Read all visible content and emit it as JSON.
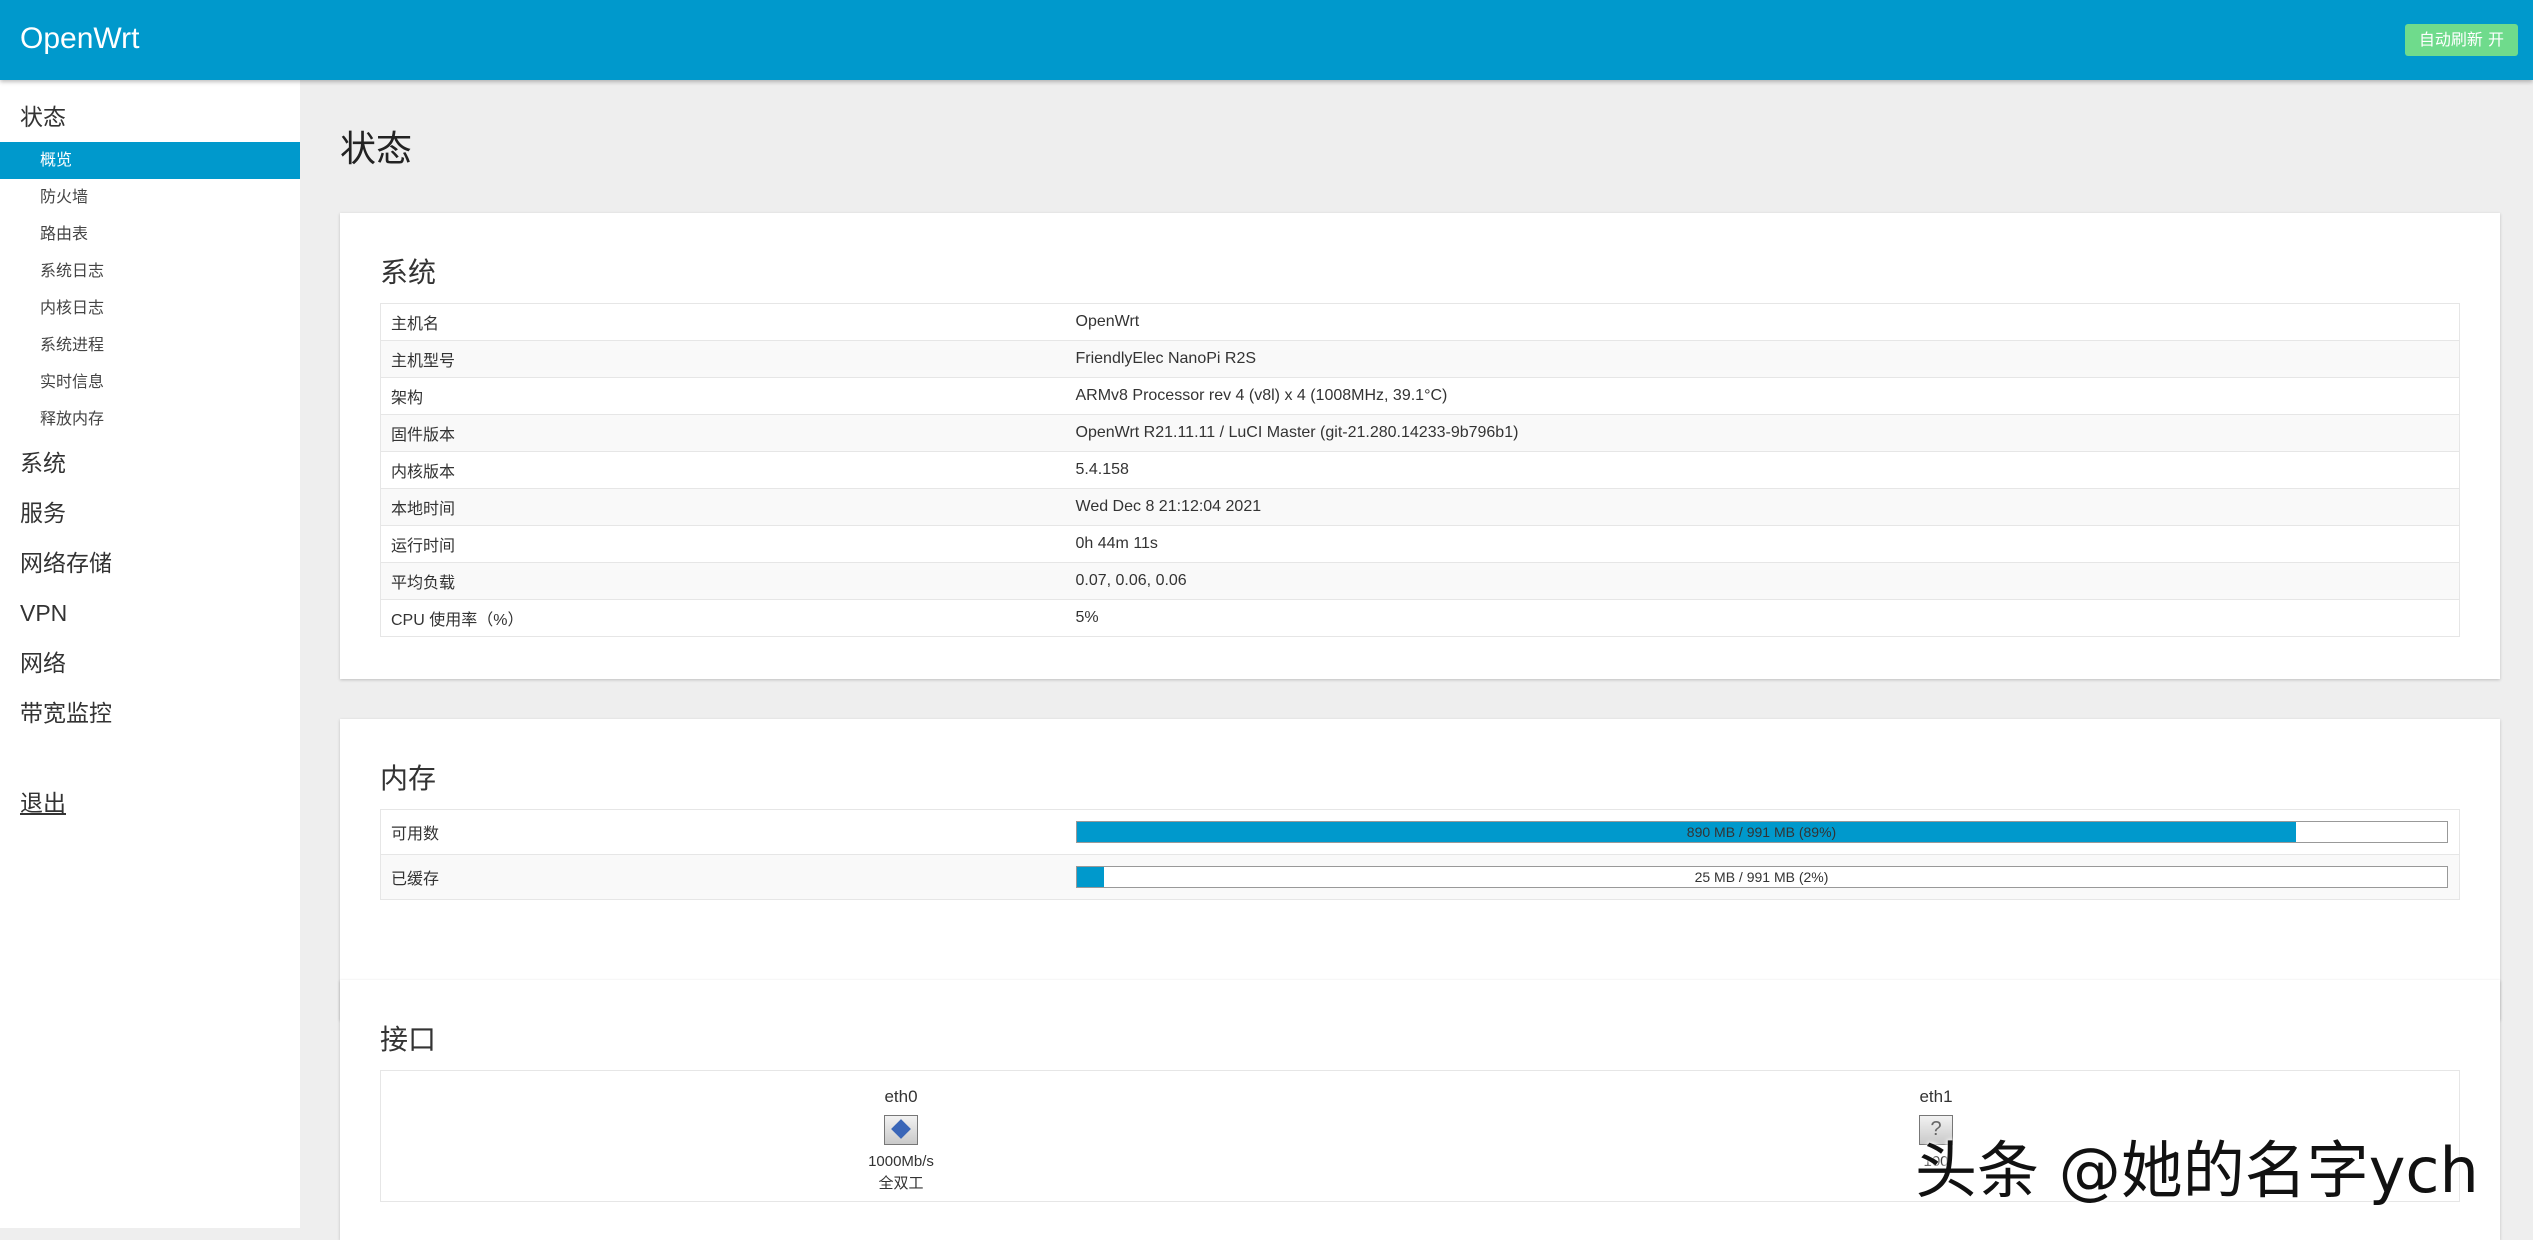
{
  "header": {
    "brand": "OpenWrt",
    "auto_refresh_label": "自动刷新 开",
    "colors": {
      "header_bg": "#0099cc",
      "refresh_bg": "#6fdb8c"
    }
  },
  "sidebar": {
    "status_label": "状态",
    "status_items": [
      "概览",
      "防火墙",
      "路由表",
      "系统日志",
      "内核日志",
      "系统进程",
      "实时信息",
      "释放内存"
    ],
    "active_item": "概览",
    "top_items": [
      "系统",
      "服务",
      "网络存储",
      "VPN",
      "网络",
      "带宽监控"
    ],
    "logout_label": "退出"
  },
  "main": {
    "page_title": "状态",
    "system": {
      "title": "系统",
      "rows": [
        {
          "key": "主机名",
          "value": "OpenWrt"
        },
        {
          "key": "主机型号",
          "value": "FriendlyElec NanoPi R2S"
        },
        {
          "key": "架构",
          "value": "ARMv8 Processor rev 4 (v8l) x 4 (1008MHz, 39.1°C)"
        },
        {
          "key": "固件版本",
          "value": "OpenWrt R21.11.11 / LuCI Master (git-21.280.14233-9b796b1)"
        },
        {
          "key": "内核版本",
          "value": "5.4.158"
        },
        {
          "key": "本地时间",
          "value": "Wed Dec 8 21:12:04 2021"
        },
        {
          "key": "运行时间",
          "value": "0h 44m 11s"
        },
        {
          "key": "平均负载",
          "value": "0.07, 0.06, 0.06"
        },
        {
          "key": "CPU 使用率（%）",
          "value": "5%"
        }
      ]
    },
    "memory": {
      "title": "内存",
      "rows": [
        {
          "key": "可用数",
          "text": "890 MB / 991 MB (89%)",
          "percent": 89
        },
        {
          "key": "已缓存",
          "text": "25 MB / 991 MB (2%)",
          "percent": 2
        }
      ]
    },
    "interfaces": {
      "title": "接口",
      "items": [
        {
          "name": "eth0",
          "speed": "1000Mb/s",
          "duplex": "全双工",
          "icon": "ethernet-connected-icon"
        },
        {
          "name": "eth1",
          "speed": "100",
          "duplex": "",
          "icon": "ethernet-unknown-icon"
        }
      ]
    }
  },
  "watermark": "头条 @她的名字ych"
}
